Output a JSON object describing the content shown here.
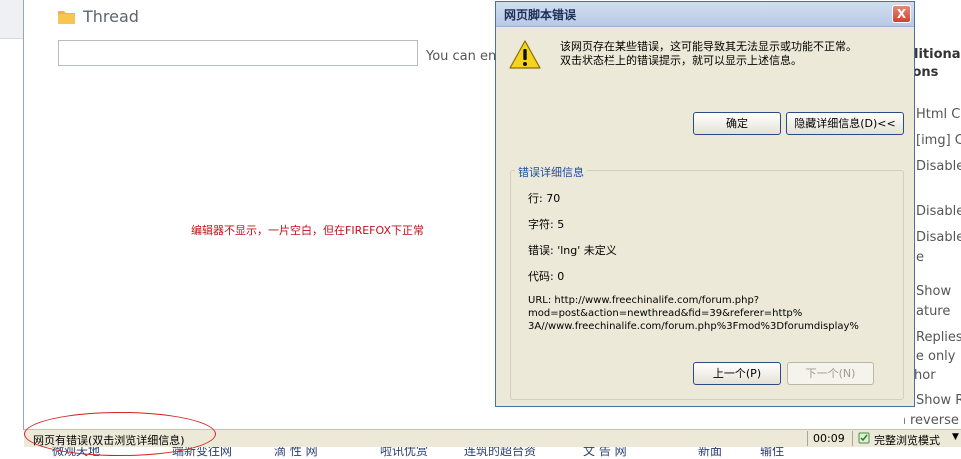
{
  "page": {
    "thread_title": "Thread",
    "hint_text": "You can en",
    "red_note": "编辑器不显示，一片空白，但在FIREFOX下正常",
    "right_column": {
      "heading_line1": "litional",
      "heading_line2": "ions",
      "items": [
        "Html Co",
        "[img] C",
        "Disable",
        "Disable",
        "Disable",
        "e",
        "Show",
        "ature",
        "Replies",
        "ble only",
        "hor",
        "Show R",
        "in reverse"
      ]
    },
    "bottom_nav": [
      "微观天地",
      "端新变往网",
      "滴 性 网",
      "啦讯优赏",
      "连筑的超台资",
      "文 告 网",
      "新面",
      "输住"
    ]
  },
  "dialog": {
    "title": "网页脚本错误",
    "close_label": "X",
    "message_line1": "该网页存在某些错误，这可能导致其无法显示或功能不正常。",
    "message_line2": "双击状态栏上的错误提示，就可以显示上述信息。",
    "ok_label": "确定",
    "hide_details_label": "隐藏详细信息(D)<<",
    "details_legend": "错误详细信息",
    "line_text": "行: 70",
    "char_text": "字符: 5",
    "error_text": "错误: 'lng' 未定义",
    "code_text": "代码: 0",
    "url_lines": [
      "URL: http://www.freechinalife.com/forum.php?",
      "mod=post&action=newthread&fid=39&referer=http%",
      "3A//www.freechinalife.com/forum.php%3Fmod%3Dforumdisplay%"
    ],
    "prev_label": "上一个(P)",
    "next_label": "下一个(N)"
  },
  "statusbar": {
    "message": "网页有错误(双击浏览详细信息)",
    "time": "00:09",
    "mode": "完整浏览模式",
    "mode_arrow": "▼"
  },
  "icons": {
    "folder": "folder-icon",
    "warning": "warning-icon",
    "close": "close-icon",
    "zone": "security-zone-icon",
    "dropdown": "dropdown-arrow-icon"
  },
  "colors": {
    "red_note": "#c0121b",
    "dialog_bg": "#ece9d8",
    "title_bar": "#b8c9e6",
    "annotation_circle": "#d32020",
    "legend_text": "#1d4ca0"
  }
}
